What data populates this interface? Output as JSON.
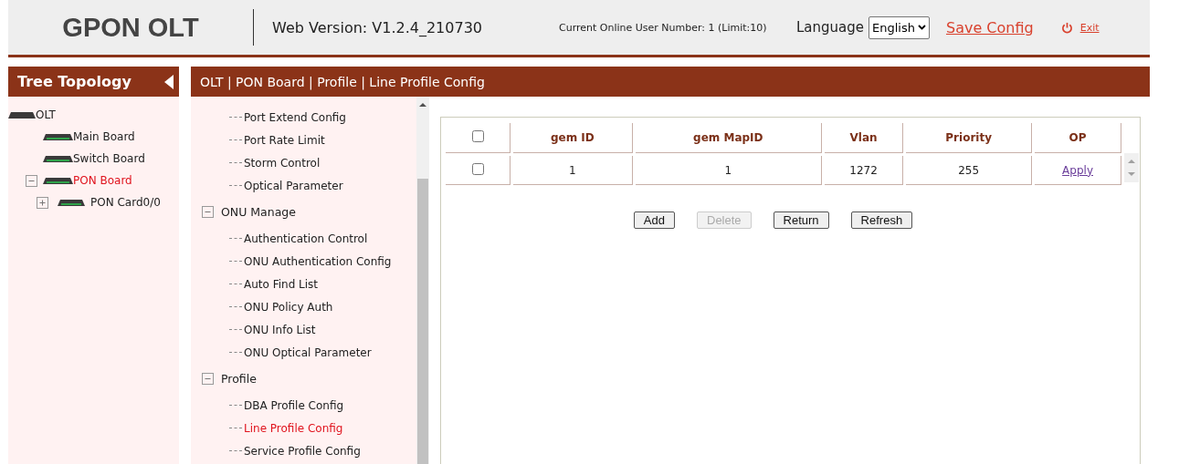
{
  "header": {
    "title": "GPON OLT",
    "version": "Web Version: V1.2.4_210730",
    "online_users": "Current Online User Number: 1 (Limit:10)",
    "language_label": "Language",
    "language_value": "English",
    "save_link": "Save Config",
    "exit_link": "Exit"
  },
  "tree_panel": {
    "title": "Tree Topology",
    "root": {
      "label": "OLT",
      "expanded": true,
      "selected": false,
      "children": [
        {
          "label": "Main Board",
          "selected": false
        },
        {
          "label": "Switch Board",
          "selected": false
        },
        {
          "label": "PON Board",
          "selected": true,
          "expanded": true,
          "children": [
            {
              "label": "PON Card0/0",
              "selected": false,
              "expanded": false
            }
          ]
        }
      ]
    }
  },
  "breadcrumb": "OLT | PON Board | Profile | Line Profile Config",
  "nav": {
    "top_items": [
      {
        "label": "Port Extend Config",
        "selected": false
      },
      {
        "label": "Port Rate Limit",
        "selected": false
      },
      {
        "label": "Storm Control",
        "selected": false
      },
      {
        "label": "Optical Parameter",
        "selected": false
      }
    ],
    "groups": [
      {
        "label": "ONU Manage",
        "expanded": true,
        "children": [
          {
            "label": "Authentication Control",
            "selected": false
          },
          {
            "label": "ONU Authentication Config",
            "selected": false
          },
          {
            "label": "Auto Find List",
            "selected": false
          },
          {
            "label": "ONU Policy Auth",
            "selected": false
          },
          {
            "label": "ONU Info List",
            "selected": false
          },
          {
            "label": "ONU Optical Parameter",
            "selected": false
          }
        ]
      },
      {
        "label": "Profile",
        "expanded": true,
        "children": [
          {
            "label": "DBA Profile Config",
            "selected": false
          },
          {
            "label": "Line Profile Config",
            "selected": true
          },
          {
            "label": "Service Profile Config",
            "selected": false
          }
        ]
      }
    ]
  },
  "table": {
    "select_all_checked": false,
    "columns": [
      "gem ID",
      "gem MapID",
      "Vlan",
      "Priority",
      "OP"
    ],
    "rows": [
      {
        "checked": false,
        "cells": [
          "1",
          "1",
          "1272",
          "255"
        ],
        "action": "Apply"
      }
    ]
  },
  "buttons": [
    {
      "label": "Add",
      "disabled": false
    },
    {
      "label": "Delete",
      "disabled": true
    },
    {
      "label": "Return",
      "disabled": false
    },
    {
      "label": "Refresh",
      "disabled": false
    }
  ]
}
